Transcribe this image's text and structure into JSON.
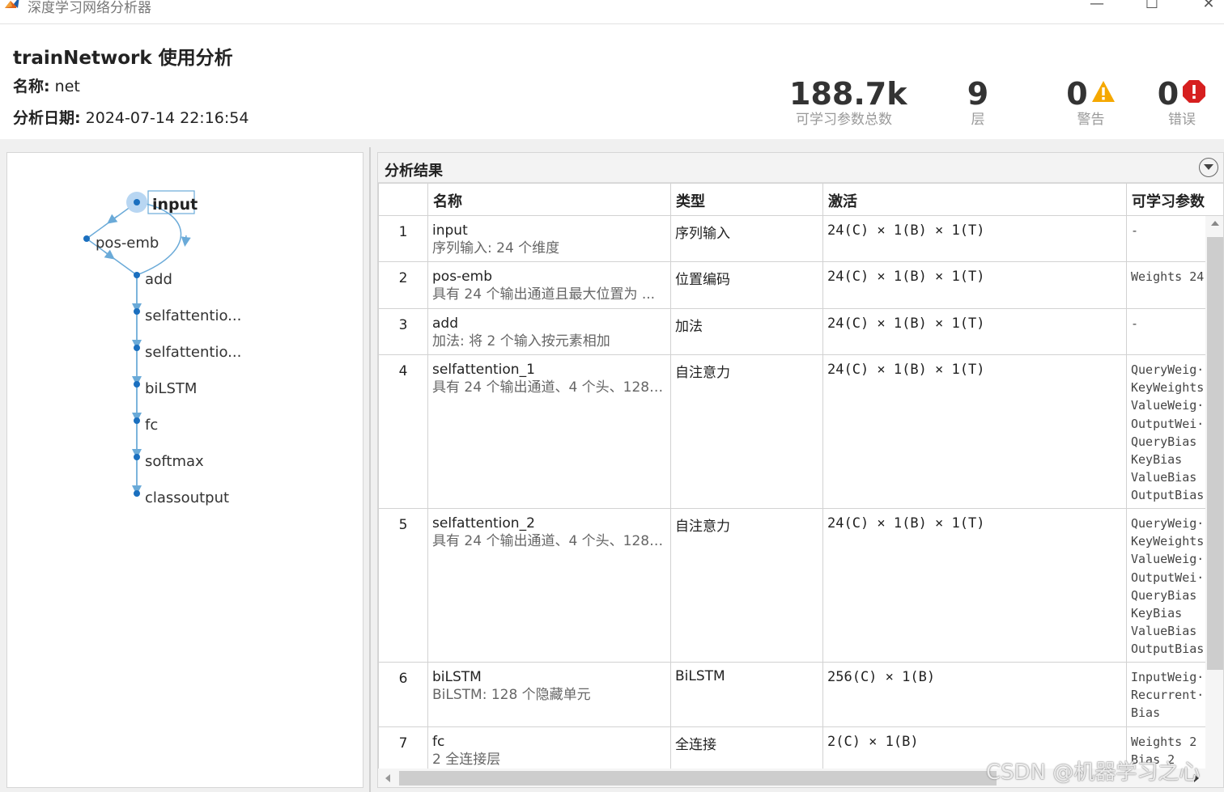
{
  "window": {
    "title": "深度学习网络分析器",
    "minimize_glyph": "—",
    "maximize_glyph": "☐",
    "close_glyph": "✕"
  },
  "header": {
    "title": "trainNetwork 使用分析",
    "name_label": "名称:",
    "name_value": "net",
    "date_label": "分析日期:",
    "date_value": "2024-07-14 22:16:54"
  },
  "stats": {
    "params_value": "188.7k",
    "params_label": "可学习参数总数",
    "layers_value": "9",
    "layers_label": "层",
    "warnings_value": "0",
    "warnings_label": "警告",
    "errors_value": "0",
    "errors_label": "错误"
  },
  "colors": {
    "warning": "#f5a800",
    "error": "#d61f1f",
    "graph_line": "#6aaad8",
    "graph_node": "#1a6fbf",
    "selected_node": "#b8d6f2"
  },
  "graph": {
    "nodes": [
      "input",
      "pos-emb",
      "add",
      "selfattentio...",
      "selfattentio...",
      "biLSTM",
      "fc",
      "softmax",
      "classoutput"
    ]
  },
  "results": {
    "title": "分析结果",
    "columns": [
      "名称",
      "类型",
      "激活",
      "可学习参数"
    ],
    "rows": [
      {
        "idx": "1",
        "name": "input",
        "desc": "序列输入: 24 个维度",
        "type": "序列输入",
        "act": "24(C) × 1(B) × 1(T)",
        "params": [
          "-"
        ]
      },
      {
        "idx": "2",
        "name": "pos-emb",
        "desc": "具有 24 个输出通道且最大位置为 ...",
        "type": "位置编码",
        "act": "24(C) × 1(B) × 1(T)",
        "params": [
          "Weights  24"
        ]
      },
      {
        "idx": "3",
        "name": "add",
        "desc": "加法: 将 2 个输入按元素相加",
        "type": "加法",
        "act": "24(C) × 1(B) × 1(T)",
        "params": [
          "-"
        ]
      },
      {
        "idx": "4",
        "name": "selfattention_1",
        "desc": "具有 24 个输出通道、4 个头、128 ...",
        "type": "自注意力",
        "act": "24(C) × 1(B) × 1(T)",
        "params": [
          "QueryWeig··",
          "KeyWeights",
          "ValueWeig··",
          "OutputWei··",
          "QueryBias",
          "KeyBias",
          "ValueBias",
          "OutputBias"
        ]
      },
      {
        "idx": "5",
        "name": "selfattention_2",
        "desc": "具有 24 个输出通道、4 个头、128 ...",
        "type": "自注意力",
        "act": "24(C) × 1(B) × 1(T)",
        "params": [
          "QueryWeig··",
          "KeyWeights",
          "ValueWeig··",
          "OutputWei··",
          "QueryBias",
          "KeyBias",
          "ValueBias",
          "OutputBias"
        ]
      },
      {
        "idx": "6",
        "name": "biLSTM",
        "desc": "BiLSTM: 128 个隐藏单元",
        "type": "BiLSTM",
        "act": "256(C) × 1(B)",
        "params": [
          "InputWeig··",
          "Recurrent··",
          "Bias"
        ]
      },
      {
        "idx": "7",
        "name": "fc",
        "desc": "2 全连接层",
        "type": "全连接",
        "act": "2(C) × 1(B)",
        "params": [
          "Weights  2",
          "Bias     2"
        ]
      }
    ]
  },
  "watermark": "CSDN @机器学习之心"
}
